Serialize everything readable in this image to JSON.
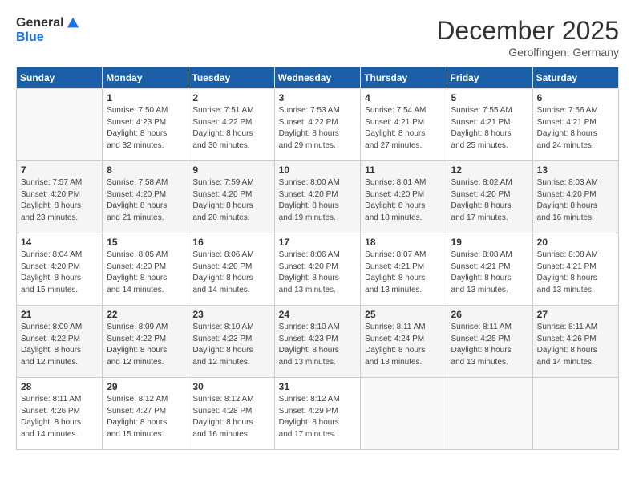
{
  "logo": {
    "general": "General",
    "blue": "Blue"
  },
  "title": "December 2025",
  "subtitle": "Gerolfingen, Germany",
  "days_header": [
    "Sunday",
    "Monday",
    "Tuesday",
    "Wednesday",
    "Thursday",
    "Friday",
    "Saturday"
  ],
  "weeks": [
    [
      {
        "num": "",
        "detail": ""
      },
      {
        "num": "1",
        "detail": "Sunrise: 7:50 AM\nSunset: 4:23 PM\nDaylight: 8 hours\nand 32 minutes."
      },
      {
        "num": "2",
        "detail": "Sunrise: 7:51 AM\nSunset: 4:22 PM\nDaylight: 8 hours\nand 30 minutes."
      },
      {
        "num": "3",
        "detail": "Sunrise: 7:53 AM\nSunset: 4:22 PM\nDaylight: 8 hours\nand 29 minutes."
      },
      {
        "num": "4",
        "detail": "Sunrise: 7:54 AM\nSunset: 4:21 PM\nDaylight: 8 hours\nand 27 minutes."
      },
      {
        "num": "5",
        "detail": "Sunrise: 7:55 AM\nSunset: 4:21 PM\nDaylight: 8 hours\nand 25 minutes."
      },
      {
        "num": "6",
        "detail": "Sunrise: 7:56 AM\nSunset: 4:21 PM\nDaylight: 8 hours\nand 24 minutes."
      }
    ],
    [
      {
        "num": "7",
        "detail": "Sunrise: 7:57 AM\nSunset: 4:20 PM\nDaylight: 8 hours\nand 23 minutes."
      },
      {
        "num": "8",
        "detail": "Sunrise: 7:58 AM\nSunset: 4:20 PM\nDaylight: 8 hours\nand 21 minutes."
      },
      {
        "num": "9",
        "detail": "Sunrise: 7:59 AM\nSunset: 4:20 PM\nDaylight: 8 hours\nand 20 minutes."
      },
      {
        "num": "10",
        "detail": "Sunrise: 8:00 AM\nSunset: 4:20 PM\nDaylight: 8 hours\nand 19 minutes."
      },
      {
        "num": "11",
        "detail": "Sunrise: 8:01 AM\nSunset: 4:20 PM\nDaylight: 8 hours\nand 18 minutes."
      },
      {
        "num": "12",
        "detail": "Sunrise: 8:02 AM\nSunset: 4:20 PM\nDaylight: 8 hours\nand 17 minutes."
      },
      {
        "num": "13",
        "detail": "Sunrise: 8:03 AM\nSunset: 4:20 PM\nDaylight: 8 hours\nand 16 minutes."
      }
    ],
    [
      {
        "num": "14",
        "detail": "Sunrise: 8:04 AM\nSunset: 4:20 PM\nDaylight: 8 hours\nand 15 minutes."
      },
      {
        "num": "15",
        "detail": "Sunrise: 8:05 AM\nSunset: 4:20 PM\nDaylight: 8 hours\nand 14 minutes."
      },
      {
        "num": "16",
        "detail": "Sunrise: 8:06 AM\nSunset: 4:20 PM\nDaylight: 8 hours\nand 14 minutes."
      },
      {
        "num": "17",
        "detail": "Sunrise: 8:06 AM\nSunset: 4:20 PM\nDaylight: 8 hours\nand 13 minutes."
      },
      {
        "num": "18",
        "detail": "Sunrise: 8:07 AM\nSunset: 4:21 PM\nDaylight: 8 hours\nand 13 minutes."
      },
      {
        "num": "19",
        "detail": "Sunrise: 8:08 AM\nSunset: 4:21 PM\nDaylight: 8 hours\nand 13 minutes."
      },
      {
        "num": "20",
        "detail": "Sunrise: 8:08 AM\nSunset: 4:21 PM\nDaylight: 8 hours\nand 13 minutes."
      }
    ],
    [
      {
        "num": "21",
        "detail": "Sunrise: 8:09 AM\nSunset: 4:22 PM\nDaylight: 8 hours\nand 12 minutes."
      },
      {
        "num": "22",
        "detail": "Sunrise: 8:09 AM\nSunset: 4:22 PM\nDaylight: 8 hours\nand 12 minutes."
      },
      {
        "num": "23",
        "detail": "Sunrise: 8:10 AM\nSunset: 4:23 PM\nDaylight: 8 hours\nand 12 minutes."
      },
      {
        "num": "24",
        "detail": "Sunrise: 8:10 AM\nSunset: 4:23 PM\nDaylight: 8 hours\nand 13 minutes."
      },
      {
        "num": "25",
        "detail": "Sunrise: 8:11 AM\nSunset: 4:24 PM\nDaylight: 8 hours\nand 13 minutes."
      },
      {
        "num": "26",
        "detail": "Sunrise: 8:11 AM\nSunset: 4:25 PM\nDaylight: 8 hours\nand 13 minutes."
      },
      {
        "num": "27",
        "detail": "Sunrise: 8:11 AM\nSunset: 4:26 PM\nDaylight: 8 hours\nand 14 minutes."
      }
    ],
    [
      {
        "num": "28",
        "detail": "Sunrise: 8:11 AM\nSunset: 4:26 PM\nDaylight: 8 hours\nand 14 minutes."
      },
      {
        "num": "29",
        "detail": "Sunrise: 8:12 AM\nSunset: 4:27 PM\nDaylight: 8 hours\nand 15 minutes."
      },
      {
        "num": "30",
        "detail": "Sunrise: 8:12 AM\nSunset: 4:28 PM\nDaylight: 8 hours\nand 16 minutes."
      },
      {
        "num": "31",
        "detail": "Sunrise: 8:12 AM\nSunset: 4:29 PM\nDaylight: 8 hours\nand 17 minutes."
      },
      {
        "num": "",
        "detail": ""
      },
      {
        "num": "",
        "detail": ""
      },
      {
        "num": "",
        "detail": ""
      }
    ]
  ]
}
